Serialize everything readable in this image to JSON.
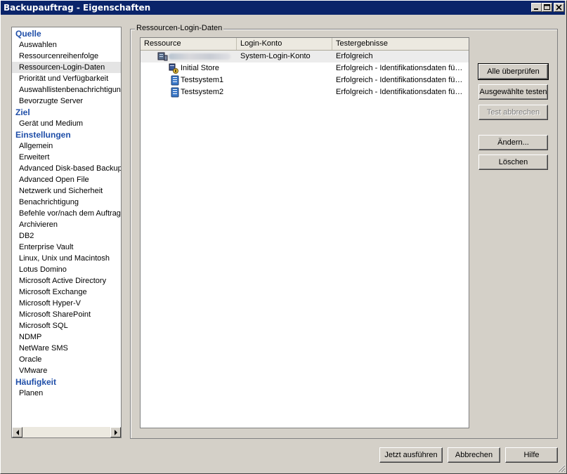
{
  "window": {
    "title": "Backupauftrag - Eigenschaften",
    "title_bg": "#0a246a",
    "controls": [
      "minimize-icon",
      "maximize-icon",
      "close-icon"
    ]
  },
  "nav": {
    "items": [
      {
        "label": "Quelle",
        "type": "heading"
      },
      {
        "label": "Auswahlen",
        "type": "item"
      },
      {
        "label": "Ressourcenreihenfolge",
        "type": "item"
      },
      {
        "label": "Ressourcen-Login-Daten",
        "type": "item",
        "selected": true
      },
      {
        "label": "Priorität und Verfügbarkeit",
        "type": "item"
      },
      {
        "label": "Auswahllistenbenachrichtigung",
        "type": "item"
      },
      {
        "label": "Bevorzugte Server",
        "type": "item"
      },
      {
        "label": "Ziel",
        "type": "heading"
      },
      {
        "label": "Gerät und Medium",
        "type": "item"
      },
      {
        "label": "Einstellungen",
        "type": "heading"
      },
      {
        "label": "Allgemein",
        "type": "item"
      },
      {
        "label": "Erweitert",
        "type": "item"
      },
      {
        "label": "Advanced Disk-based Backup",
        "type": "item"
      },
      {
        "label": "Advanced Open File",
        "type": "item"
      },
      {
        "label": "Netzwerk und Sicherheit",
        "type": "item"
      },
      {
        "label": "Benachrichtigung",
        "type": "item"
      },
      {
        "label": "Befehle vor/nach dem Auftrag",
        "type": "item"
      },
      {
        "label": "Archivieren",
        "type": "item"
      },
      {
        "label": "DB2",
        "type": "item"
      },
      {
        "label": "Enterprise Vault",
        "type": "item"
      },
      {
        "label": "Linux, Unix und Macintosh",
        "type": "item"
      },
      {
        "label": "Lotus Domino",
        "type": "item"
      },
      {
        "label": "Microsoft Active Directory",
        "type": "item"
      },
      {
        "label": "Microsoft Exchange",
        "type": "item"
      },
      {
        "label": "Microsoft Hyper-V",
        "type": "item"
      },
      {
        "label": "Microsoft SharePoint",
        "type": "item"
      },
      {
        "label": "Microsoft SQL",
        "type": "item"
      },
      {
        "label": "NDMP",
        "type": "item"
      },
      {
        "label": "NetWare SMS",
        "type": "item"
      },
      {
        "label": "Oracle",
        "type": "item"
      },
      {
        "label": "VMware",
        "type": "item"
      },
      {
        "label": "Häufigkeit",
        "type": "heading"
      },
      {
        "label": "Planen",
        "type": "item"
      }
    ],
    "heading_color": "#1f4ea8"
  },
  "group": {
    "label": "Ressourcen-Login-Daten"
  },
  "table": {
    "columns": [
      "Ressource",
      "Login-Konto",
      "Testergebnisse"
    ],
    "rows": [
      {
        "resource": "",
        "account": "System-Login-Konto",
        "result": "Erfolgreich",
        "icon": "server-icon",
        "level": 0,
        "selected": true
      },
      {
        "resource": "Initial Store",
        "account": "",
        "result": "Erfolgreich - Identifikationsdaten fü…",
        "icon": "store-icon",
        "level": 1
      },
      {
        "resource": "Testsystem1",
        "account": "",
        "result": "Erfolgreich - Identifikationsdaten fü…",
        "icon": "database-icon",
        "level": 1
      },
      {
        "resource": "Testsystem2",
        "account": "",
        "result": "Erfolgreich - Identifikationsdaten fü…",
        "icon": "database-icon",
        "level": 1
      }
    ]
  },
  "side_buttons": {
    "check_all": "Alle überprüfen",
    "test_selected": "Ausgewählte testen",
    "cancel_test": "Test abbrechen",
    "edit": "Ändern...",
    "delete": "Löschen"
  },
  "footer": {
    "run_now": "Jetzt ausführen",
    "cancel": "Abbrechen",
    "help": "Hilfe"
  }
}
